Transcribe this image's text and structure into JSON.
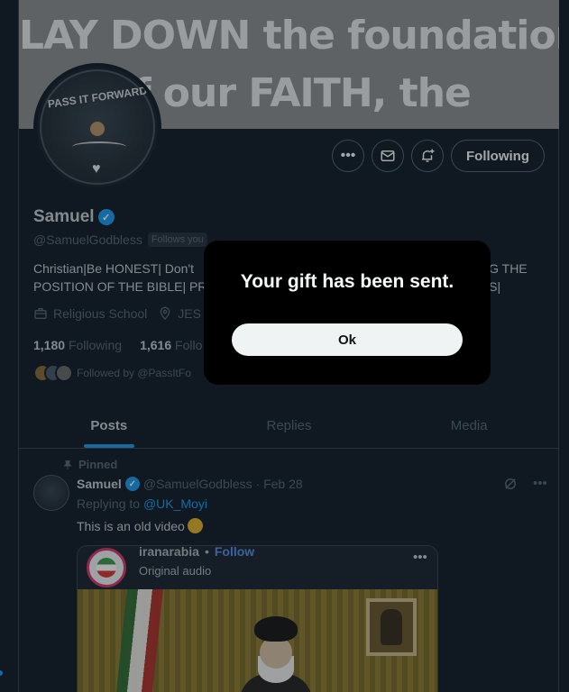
{
  "banner": {
    "lines": [
      "…",
      "LAY DOWN the foundation",
      "of our FAITH, the"
    ]
  },
  "avatar": {
    "text": "PASS IT FORWARD"
  },
  "actions": {
    "more_icon": "more-horizontal-icon",
    "message_icon": "envelope-icon",
    "notify_icon": "bell-plus-icon",
    "following_label": "Following"
  },
  "profile": {
    "name": "Samuel",
    "handle": "@SamuelGodbless",
    "follows_you": "Follows you",
    "bio_line1_left": "Christian|Be HONEST| Don't",
    "bio_line1_right": "NG THE",
    "bio_line2_left": "POSITION OF THE BIBLE| PRO",
    "bio_line2_right": "RS|",
    "category": "Religious School",
    "location": "JES",
    "following_count": "1,180",
    "following_label": "Following",
    "followers_count": "1,616",
    "followers_label": "Follo",
    "followed_by": "Followed by @PassItFo"
  },
  "tabs": [
    "Posts",
    "Replies",
    "Media"
  ],
  "post": {
    "pinned_label": "Pinned",
    "name": "Samuel",
    "handle_date": "@SamuelGodbless · Feb 28",
    "replying_prefix": "Replying to",
    "replying_handle": "@UK_Moyi",
    "text": "This is an old video",
    "embed": {
      "name": "iranarabia",
      "dot": "•",
      "follow": "Follow",
      "subtitle": "Original audio"
    }
  },
  "dialog": {
    "message": "Your gift has been sent.",
    "ok_label": "Ok"
  },
  "colors": {
    "background": "#15202b",
    "accent": "#1d9bf0",
    "dialog_bg": "#000000",
    "border": "#38444d"
  }
}
